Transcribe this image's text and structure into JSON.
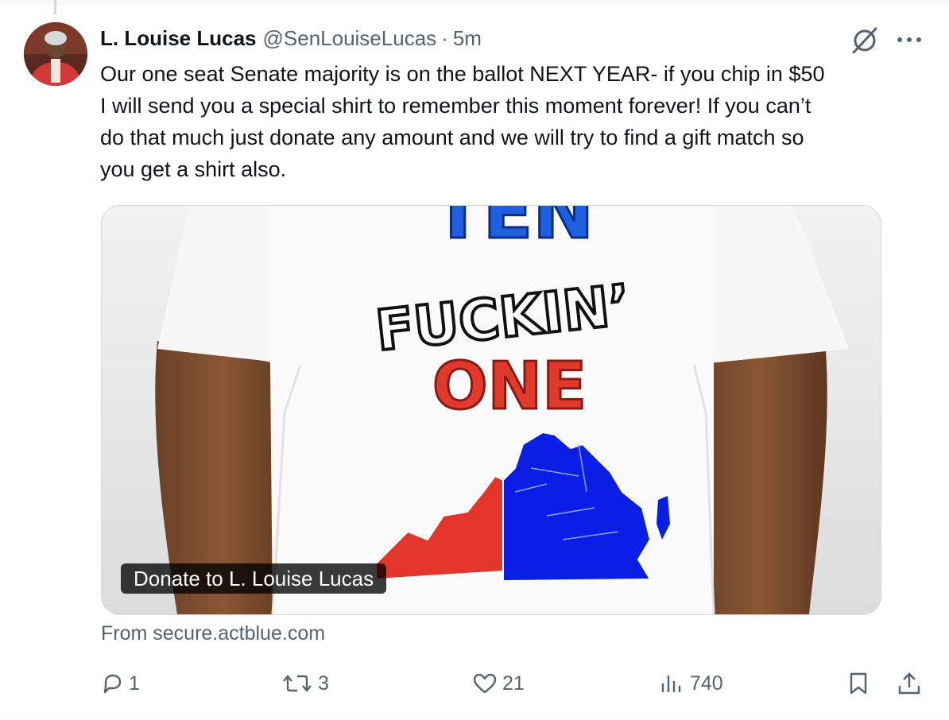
{
  "tweet": {
    "author_name": "L. Louise Lucas",
    "handle": "@SenLouiseLucas",
    "separator": "·",
    "time": "5m",
    "text_lines": [
      "Our one seat Senate majority is on the ballot NEXT YEAR- if you chip in $50",
      "I will send you a special shirt to remember this moment forever!  If you can’t",
      "do that much just donate any amount and we will try to find a gift match so",
      "you get a shirt also."
    ]
  },
  "card": {
    "label": "Donate to L. Louise Lucas",
    "source": "From secure.actblue.com",
    "shirt_words": [
      "TEN",
      "FUCKIN’",
      "ONE"
    ]
  },
  "actions": {
    "replies": "1",
    "reposts": "3",
    "likes": "21",
    "views": "740"
  },
  "icons": {
    "reply": "reply-icon",
    "repost": "repost-icon",
    "like": "heart-icon",
    "views": "views-icon",
    "bookmark": "bookmark-icon",
    "share": "share-icon",
    "grok": "grok-icon",
    "more": "more-icon"
  },
  "colors": {
    "text": "#0f1419",
    "secondary": "#536471",
    "border": "#cfd9de",
    "shirt_blue": "#1f5fe0",
    "shirt_red": "#e03a2c",
    "map_blue": "#0a1ee6",
    "map_red": "#e3352a"
  }
}
